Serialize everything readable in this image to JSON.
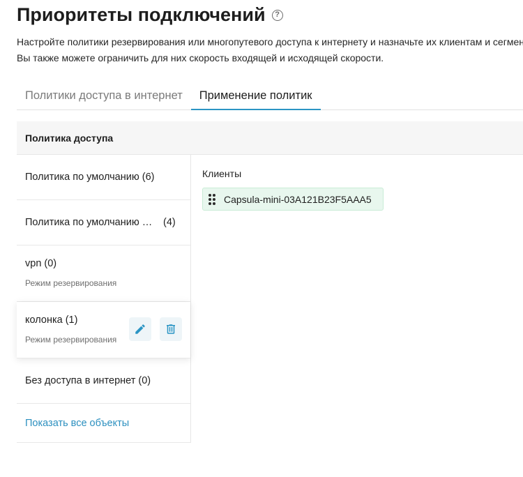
{
  "header": {
    "title": "Приоритеты подключений",
    "help_icon": "help-circle-icon",
    "description": "Настройте политики резервирования или многопутевого доступа к интернету и назначьте их клиентам и сегментам. Вы также можете ограничить для них скорость входящей и исходящей скорости."
  },
  "tabs": [
    {
      "label": "Политики доступа в интернет",
      "active": false
    },
    {
      "label": "Применение политик",
      "active": true
    }
  ],
  "policy_panel": {
    "header": "Политика доступа",
    "items": [
      {
        "name": "Политика по умолчанию (6)"
      },
      {
        "name": "Политика по умолчанию сегмента",
        "count": "(4)"
      },
      {
        "name": "vpn (0)",
        "mode": "Режим резервирования"
      },
      {
        "name": "колонка (1)",
        "mode": "Режим резервирования",
        "edit_icon": "pencil-icon",
        "delete_icon": "trash-icon"
      },
      {
        "name": "Без доступа в интернет (0)"
      }
    ],
    "show_all": "Показать все объекты"
  },
  "clients": {
    "label": "Клиенты",
    "items": [
      {
        "name": "Capsula-mini-03A121B23F5AAA5",
        "icon": "drag-handle-icon"
      }
    ]
  },
  "colors": {
    "accent": "#2b95c4",
    "link": "#2b8fbf",
    "chip_bg": "#e8f7ee",
    "panel_header_bg": "#f6f6f6"
  }
}
